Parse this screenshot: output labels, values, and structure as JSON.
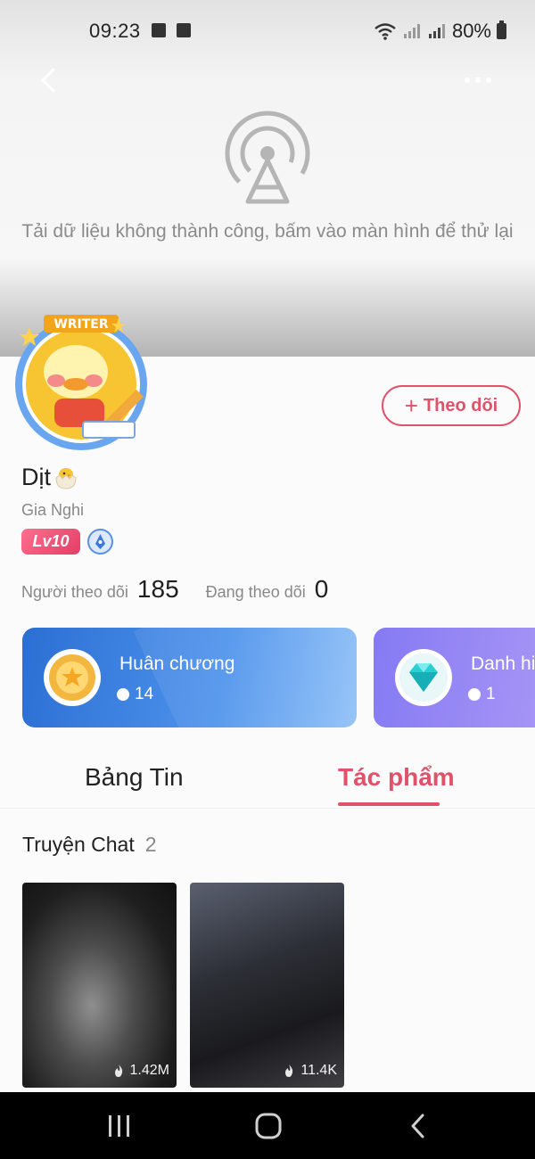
{
  "status_bar": {
    "time": "09:23",
    "battery": "80%"
  },
  "error": {
    "message": "Tải dữ liệu không thành công, bấm vào màn hình để thử lại"
  },
  "profile": {
    "nickname": "Dịt",
    "username": "Gia Nghi",
    "level": "Lv10",
    "follow_button": "Theo dõi",
    "followers_label": "Người theo dõi",
    "followers_count": "185",
    "following_label": "Đang theo dõi",
    "following_count": "0"
  },
  "cards": [
    {
      "label": "Huân chương",
      "count": "14",
      "icon": "medal-icon",
      "color": "#2c6fd4"
    },
    {
      "label": "Danh hi",
      "count": "1",
      "icon": "diamond-icon",
      "color": "#7b6ff2"
    }
  ],
  "tabs": [
    {
      "label": "Bảng Tin",
      "active": false
    },
    {
      "label": "Tác phẩm",
      "active": true
    }
  ],
  "section": {
    "title": "Truyện Chat",
    "count": "2"
  },
  "works": [
    {
      "views": "1.42M"
    },
    {
      "views": "11.4K"
    }
  ],
  "colors": {
    "accent": "#e0516a",
    "medal_card": "#2c6fd4",
    "title_card": "#7b6ff2"
  }
}
